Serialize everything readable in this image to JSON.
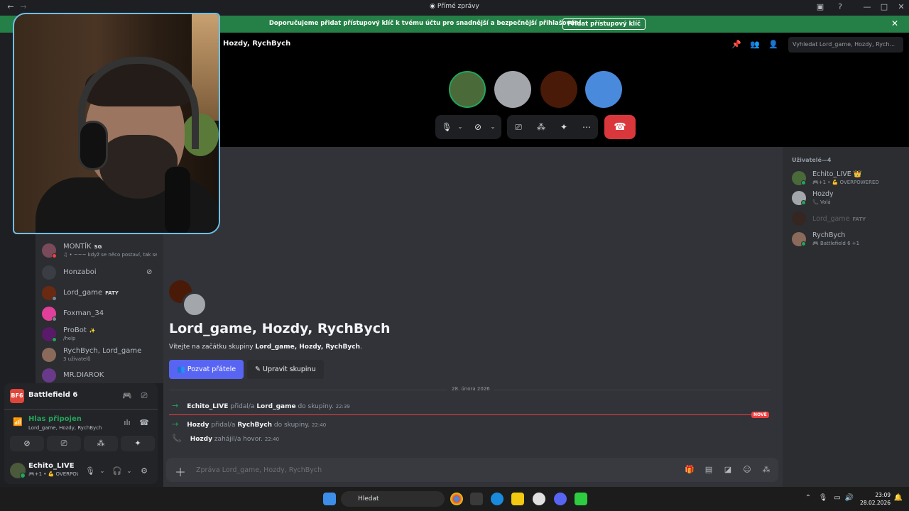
{
  "window": {
    "title": "Přímé zprávy"
  },
  "banner": {
    "text": "Doporučujeme přidat přístupový klíč k tvému účtu pro snadnější a bezpečnější přihlašování.",
    "button": "Přidat přístupový klíč"
  },
  "dm_list": [
    {
      "name": "MONTÍK",
      "badge": "SG",
      "sub": "♫ • ~~~ když se něco postaví, tak se n",
      "color": "#7a4a5a",
      "status": "#f23f42"
    },
    {
      "name": "Honzaboi",
      "badge": "",
      "sub": "",
      "color": "#3a3d44",
      "status": ""
    },
    {
      "name": "Lord_game",
      "badge": "FATY",
      "sub": "",
      "color": "#6a2a12",
      "status": "#80848e"
    },
    {
      "name": "Foxman_34",
      "badge": "",
      "sub": "",
      "color": "#e0409a",
      "status": "#80848e"
    },
    {
      "name": "ProBot",
      "badge": "✨",
      "sub": "/help",
      "color": "#5a1a6a",
      "status": "#23a55a"
    },
    {
      "name": "RychBych, Lord_game",
      "badge": "",
      "sub": "3 uživatelů",
      "color": "#8a6a5a",
      "status": ""
    },
    {
      "name": "MR.DIAROK",
      "badge": "",
      "sub": "",
      "color": "#6a3a8a",
      "status": ""
    }
  ],
  "activity": {
    "game_icon": "BF6",
    "game": "Battlefield 6"
  },
  "voice": {
    "state": "Hlas připojen",
    "channel": "Lord_game, Hozdy, RychBych"
  },
  "user": {
    "name": "Echito_LIVE",
    "status": "🎮+1 • 💪 OVERPOWERED"
  },
  "call": {
    "title": "Hozdy, RychBych",
    "search_placeholder": "Vyhledat Lord_game, Hozdy, Rych...",
    "participants": [
      {
        "name": "Echito_LIVE",
        "color": "#4a6a3a",
        "ring": "#23a55a"
      },
      {
        "name": "Hozdy",
        "color": "#a3a6aa",
        "ring": ""
      },
      {
        "name": "Lord_game",
        "color": "#4a1a08",
        "ring": ""
      },
      {
        "name": "RychBych",
        "color": "#4a8adc",
        "ring": ""
      }
    ]
  },
  "chat": {
    "welcome_title": "Lord_game, Hozdy, RychBych",
    "welcome_prefix": "Vítejte na začátku skupiny ",
    "welcome_group": "Lord_game, Hozdy, RychBych",
    "welcome_suffix": ".",
    "invite_button": "Pozvat přátele",
    "edit_button": "Upravit skupinu",
    "date_label": "28. února 2026",
    "new_label": "NOVÉ",
    "messages": [
      {
        "actor": "Echito_LIVE",
        "verb": " přidal/a ",
        "target": "Lord_game",
        "rest": " do skupiny. ",
        "time": "22:39"
      },
      {
        "actor": "Hozdy",
        "verb": " přidal/a ",
        "target": "RychBych",
        "rest": " do skupiny. ",
        "time": "22:40"
      },
      {
        "actor": "Hozdy",
        "verb": " zahájil/a hovor. ",
        "target": "",
        "rest": "",
        "time": "22:40"
      }
    ],
    "composer_placeholder": "Zpráva Lord_game, Hozdy, RychBych"
  },
  "members": {
    "header": "Uživatelé—4",
    "list": [
      {
        "name": "Echito_LIVE 👑",
        "sub": "🎮+1 • 💪 OVERPOWERED",
        "color": "#4a6a3a",
        "status": "#23a55a",
        "offline": false
      },
      {
        "name": "Hozdy",
        "sub": "📞 Volá",
        "color": "#a3a6aa",
        "status": "#23a55a",
        "offline": false
      },
      {
        "name": "Lord_game",
        "sub": "",
        "color": "#4a1a08",
        "status": "",
        "offline": true,
        "badge": "FATY"
      },
      {
        "name": "RychBych",
        "sub": "🎮 Battlefield 6 +1",
        "color": "#8a6a5a",
        "status": "#23a55a",
        "offline": false
      }
    ]
  },
  "taskbar": {
    "search": "Hledat",
    "time": "23:09",
    "date": "28.02.2026"
  }
}
